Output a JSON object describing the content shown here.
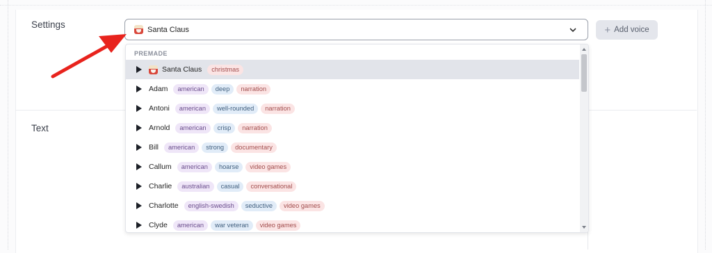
{
  "settings": {
    "label": "Settings"
  },
  "text_section": {
    "label": "Text"
  },
  "voice_select": {
    "selected_name": "Santa Claus"
  },
  "add_voice": {
    "label": "Add voice"
  },
  "dropdown": {
    "group_label": "PREMADE",
    "voices": [
      {
        "name": "Santa Claus",
        "emoji": true,
        "selected": true,
        "tags": [
          {
            "label": "christmas",
            "color": "red"
          }
        ]
      },
      {
        "name": "Adam",
        "tags": [
          {
            "label": "american",
            "color": "purple"
          },
          {
            "label": "deep",
            "color": "blue"
          },
          {
            "label": "narration",
            "color": "red"
          }
        ]
      },
      {
        "name": "Antoni",
        "tags": [
          {
            "label": "american",
            "color": "purple"
          },
          {
            "label": "well-rounded",
            "color": "blue"
          },
          {
            "label": "narration",
            "color": "red"
          }
        ]
      },
      {
        "name": "Arnold",
        "tags": [
          {
            "label": "american",
            "color": "purple"
          },
          {
            "label": "crisp",
            "color": "blue"
          },
          {
            "label": "narration",
            "color": "red"
          }
        ]
      },
      {
        "name": "Bill",
        "tags": [
          {
            "label": "american",
            "color": "purple"
          },
          {
            "label": "strong",
            "color": "blue"
          },
          {
            "label": "documentary",
            "color": "red"
          }
        ]
      },
      {
        "name": "Callum",
        "tags": [
          {
            "label": "american",
            "color": "purple"
          },
          {
            "label": "hoarse",
            "color": "blue"
          },
          {
            "label": "video games",
            "color": "red"
          }
        ]
      },
      {
        "name": "Charlie",
        "tags": [
          {
            "label": "australian",
            "color": "purple"
          },
          {
            "label": "casual",
            "color": "blue"
          },
          {
            "label": "conversational",
            "color": "red"
          }
        ]
      },
      {
        "name": "Charlotte",
        "tags": [
          {
            "label": "english-swedish",
            "color": "purple"
          },
          {
            "label": "seductive",
            "color": "blue"
          },
          {
            "label": "video games",
            "color": "red"
          }
        ]
      },
      {
        "name": "Clyde",
        "tags": [
          {
            "label": "american",
            "color": "purple"
          },
          {
            "label": "war veteran",
            "color": "blue"
          },
          {
            "label": "video games",
            "color": "red"
          }
        ]
      }
    ]
  },
  "colors": {
    "annotation_arrow": "#e8231d",
    "selected_row": "#e2e4ea"
  }
}
